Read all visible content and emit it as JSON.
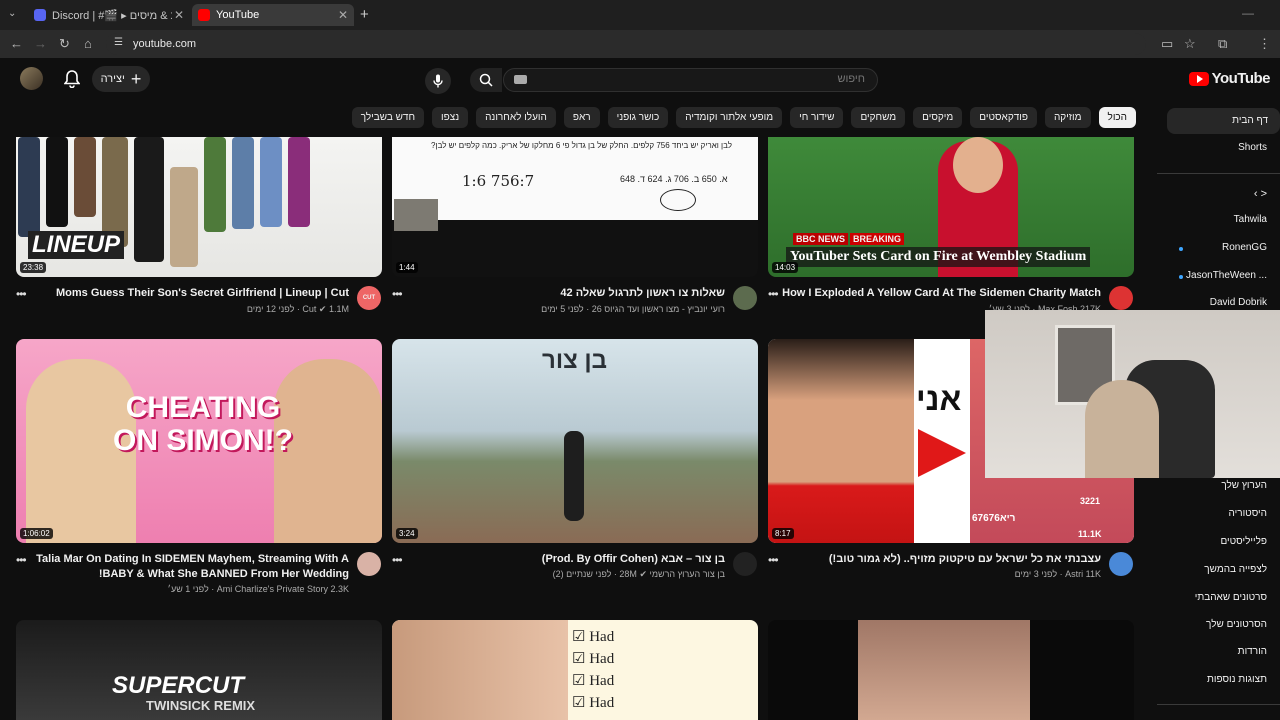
{
  "browser": {
    "tabs": [
      {
        "label": "Discord | #🎬 ▸ חנות & מיסים",
        "active": false
      },
      {
        "label": "YouTube",
        "active": true
      }
    ],
    "new_tab": "+",
    "url": "youtube.com"
  },
  "header": {
    "logo_text": "YouTube",
    "search_placeholder": "חיפוש",
    "create_label": "יצירה"
  },
  "chips": [
    "הכול",
    "מוזיקה",
    "פודקאסטים",
    "מיקסים",
    "משחקים",
    "שידור חי",
    "מופעי אלתור וקומדיה",
    "כושר גופני",
    "ראפ",
    "הועלו לאחרונה",
    "נצפו",
    "חדש בשבילך"
  ],
  "sidebar": {
    "home": "דף הבית",
    "shorts": "Shorts",
    "subs_chevron": "‹  >",
    "channels": [
      "Tahwila",
      "RonenGG",
      "JasonTheWeen ...",
      "David Dobrik"
    ],
    "you_items": [
      "הערוץ שלך",
      "היסטוריה",
      "פלייליסטים",
      "לצפייה בהמשך",
      "סרטונים שאהבתי",
      "הסרטונים שלך",
      "הורדות",
      "תצוגות נוספות"
    ]
  },
  "videos": [
    {
      "title": "Moms Guess Their Son's Secret Girlfriend | Lineup | Cut",
      "channel": "Cut",
      "meta": "1.1M · לפני 12 ימים",
      "duration": "23:38",
      "overlay": "LINEUP",
      "channel_avatar_text": "CUT"
    },
    {
      "title": "שאלות צו ראשון לתרגול שאלה 42",
      "channel": "רועי יונביץ - מצו ראשון ועד הגיוס",
      "meta": "26 · לפני 5 ימים",
      "duration": "1:44",
      "board_line1": "לבן ואריק יש ביחד 756 קלפים. החלק של בן גדול פי 6 מחלקו של אריק. כמה קלפים יש לבן?",
      "board_line2": "א. 650  ב. 706  ג. 624  ד. 648"
    },
    {
      "title": "How I Exploded A Yellow Card At The Sidemen Charity Match",
      "channel": "Max Fosh",
      "meta": "217K · לפני 3 שע׳",
      "duration": "14:03",
      "overlay": "YouTuber Sets Card on Fire at Wembley Stadium",
      "badge1": "BBC NEWS",
      "badge2": "BREAKING"
    },
    {
      "title": "Talia Mar On Dating In SIDEMEN Mayhem, Streaming With A",
      "title2": "BABY & What She BANNED From Her Wedding!",
      "channel": "Ami Charlize's Private Story",
      "meta": "2.3K · לפני 1 שע׳",
      "duration": "1:06:02",
      "overlay": "CHEATING ON SIMON!?"
    },
    {
      "title": "בן צור – אבא (Prod. By Offir Cohen)",
      "channel": "בן צור הערוץ הרשמי",
      "meta": "28M · לפני שנתיים (2)",
      "duration": "3:24",
      "overlay": "בן צור"
    },
    {
      "title": "עצבנתי את כל ישראל עם טיקטוק מזויף.. (לא גמור טוב!)",
      "channel": "Astri",
      "meta": "11K · לפני 3 ימים",
      "duration": "8:17",
      "overlay": "אני",
      "tiktok_user": "ריא67676",
      "tiktok_comments": "3221",
      "tiktok_shares": "11.1K"
    },
    {
      "overlay": "SUPERCUT",
      "overlay_sub": "TWINSICK REMIX"
    },
    {
      "checklist": [
        "Had",
        "Had",
        "Had",
        "Had"
      ]
    },
    {}
  ],
  "colors": {
    "accent": "#ff0000",
    "bg": "#0f0f0f",
    "chip_bg": "#272727",
    "verified": "#aaaaaa"
  }
}
